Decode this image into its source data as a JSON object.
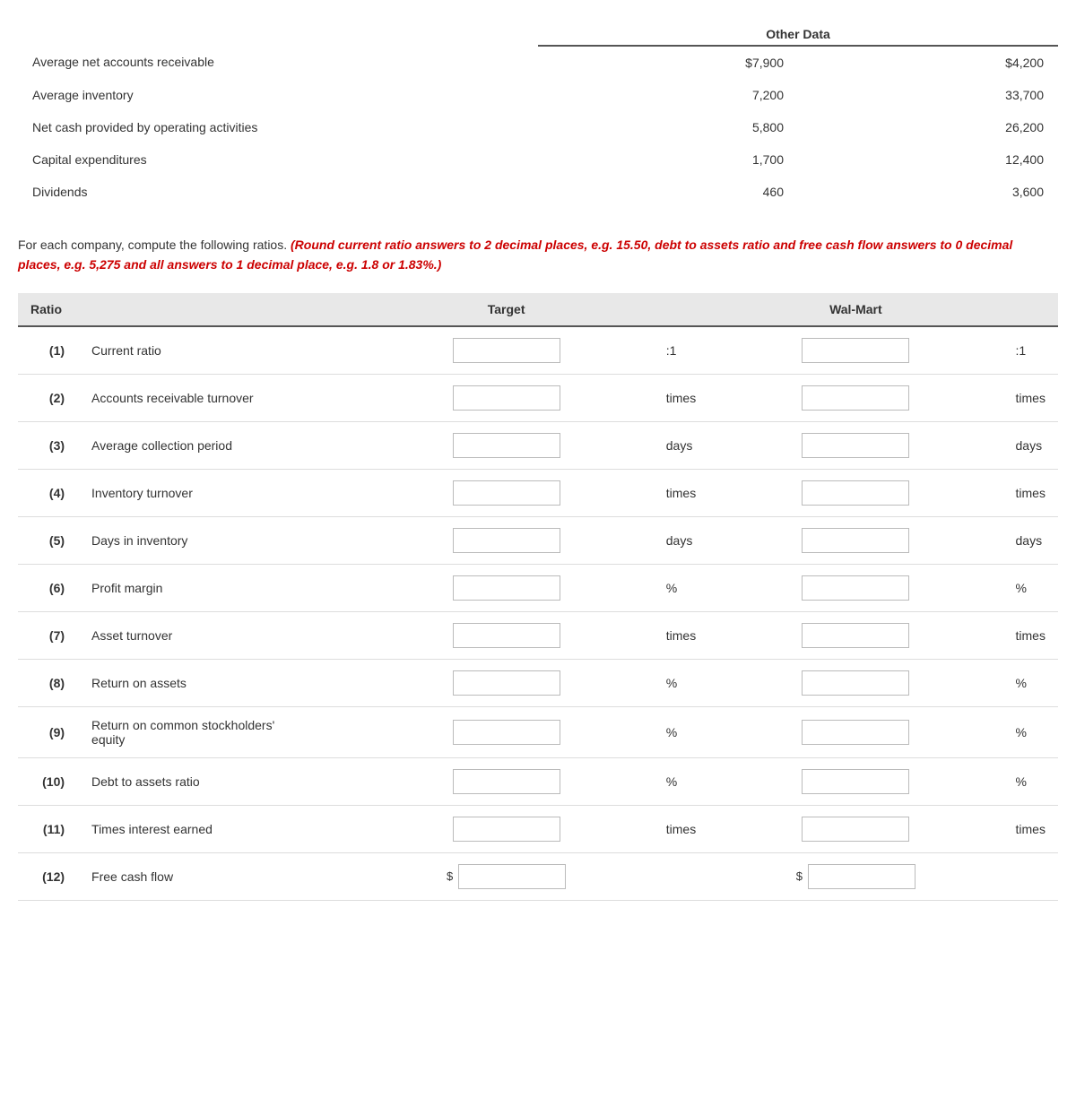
{
  "otherData": {
    "sectionTitle": "Other Data",
    "columns": [
      "",
      "Target",
      "Wal-Mart"
    ],
    "rows": [
      {
        "label": "Average net accounts receivable",
        "target": "$7,900",
        "walmart": "$4,200"
      },
      {
        "label": "Average inventory",
        "target": "7,200",
        "walmart": "33,700"
      },
      {
        "label": "Net cash provided by operating activities",
        "target": "5,800",
        "walmart": "26,200"
      },
      {
        "label": "Capital expenditures",
        "target": "1,700",
        "walmart": "12,400"
      },
      {
        "label": "Dividends",
        "target": "460",
        "walmart": "3,600"
      }
    ]
  },
  "instruction": {
    "prefix": "For each company, compute the following ratios.",
    "bold": " (Round current ratio answers to 2 decimal places, e.g. 15.50, debt to assets ratio and free cash flow answers to 0 decimal places, e.g. 5,275 and all answers to 1 decimal place, e.g. 1.8 or 1.83%.)"
  },
  "ratiosTable": {
    "headers": {
      "ratio": "Ratio",
      "target": "Target",
      "walmart": "Wal-Mart"
    },
    "rows": [
      {
        "num": "(1)",
        "label": "Current ratio",
        "targetUnit": ":1",
        "walmartUnit": ":1",
        "type": "unit"
      },
      {
        "num": "(2)",
        "label": "Accounts receivable turnover",
        "targetUnit": "times",
        "walmartUnit": "times",
        "type": "unit"
      },
      {
        "num": "(3)",
        "label": "Average collection period",
        "targetUnit": "days",
        "walmartUnit": "days",
        "type": "unit"
      },
      {
        "num": "(4)",
        "label": "Inventory turnover",
        "targetUnit": "times",
        "walmartUnit": "times",
        "type": "unit"
      },
      {
        "num": "(5)",
        "label": "Days in inventory",
        "targetUnit": "days",
        "walmartUnit": "days",
        "type": "unit"
      },
      {
        "num": "(6)",
        "label": "Profit margin",
        "targetUnit": "%",
        "walmartUnit": "%",
        "type": "unit"
      },
      {
        "num": "(7)",
        "label": "Asset turnover",
        "targetUnit": "times",
        "walmartUnit": "times",
        "type": "unit"
      },
      {
        "num": "(8)",
        "label": "Return on assets",
        "targetUnit": "%",
        "walmartUnit": "%",
        "type": "unit"
      },
      {
        "num": "(9)",
        "label": "Return on common stockholders'\nequity",
        "targetUnit": "%",
        "walmartUnit": "%",
        "type": "unit"
      },
      {
        "num": "(10)",
        "label": "Debt to assets ratio",
        "targetUnit": "%",
        "walmartUnit": "%",
        "type": "unit"
      },
      {
        "num": "(11)",
        "label": "Times interest earned",
        "targetUnit": "times",
        "walmartUnit": "times",
        "type": "unit"
      },
      {
        "num": "(12)",
        "label": "Free cash flow",
        "targetUnit": "",
        "walmartUnit": "",
        "type": "dollar"
      }
    ]
  }
}
